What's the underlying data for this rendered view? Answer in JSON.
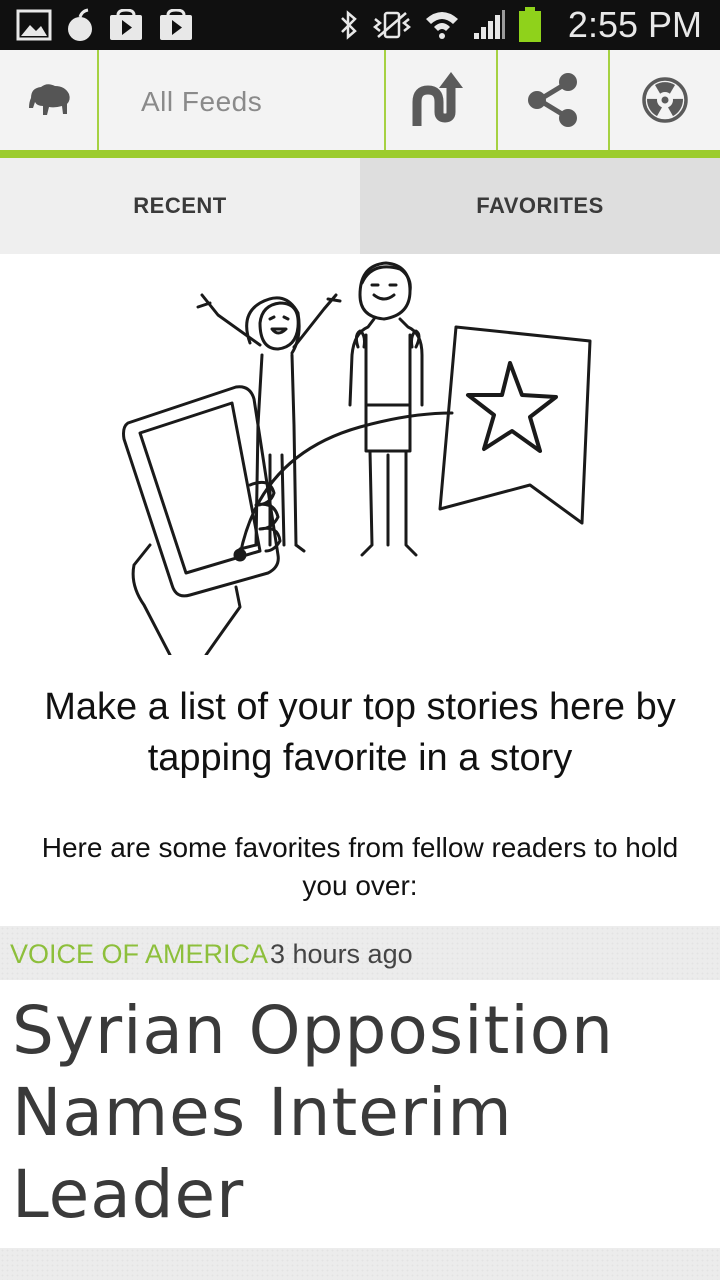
{
  "status_bar": {
    "time": "2:55 PM",
    "notification_icons": [
      "gallery-icon",
      "fruit-icon",
      "play-store-icon",
      "play-store-bag-icon"
    ],
    "system_icons": [
      "bluetooth-icon",
      "vibrate-icon",
      "wifi-icon",
      "signal-icon",
      "battery-icon"
    ],
    "battery_color": "#8fd21b"
  },
  "action_bar": {
    "feed_label": "All Feeds",
    "accent_color": "#9ccc2e",
    "icons": {
      "logo": "buffalo-icon",
      "refresh": "refresh-arrow-icon",
      "share": "share-icon",
      "settings": "radiation-icon"
    }
  },
  "tabs": [
    {
      "label": "RECENT",
      "selected": false
    },
    {
      "label": "FAVORITES",
      "selected": true
    }
  ],
  "empty_state": {
    "headline": "Make a list of your top stories here by tapping favorite in a story",
    "subtext": "Here are some favorites from fellow readers to hold you over:"
  },
  "story": {
    "source": "VOICE OF AMERICA",
    "time": "3 hours ago",
    "title": "Syrian Opposition Names Interim Leader",
    "source_color": "#8dbf3b"
  }
}
